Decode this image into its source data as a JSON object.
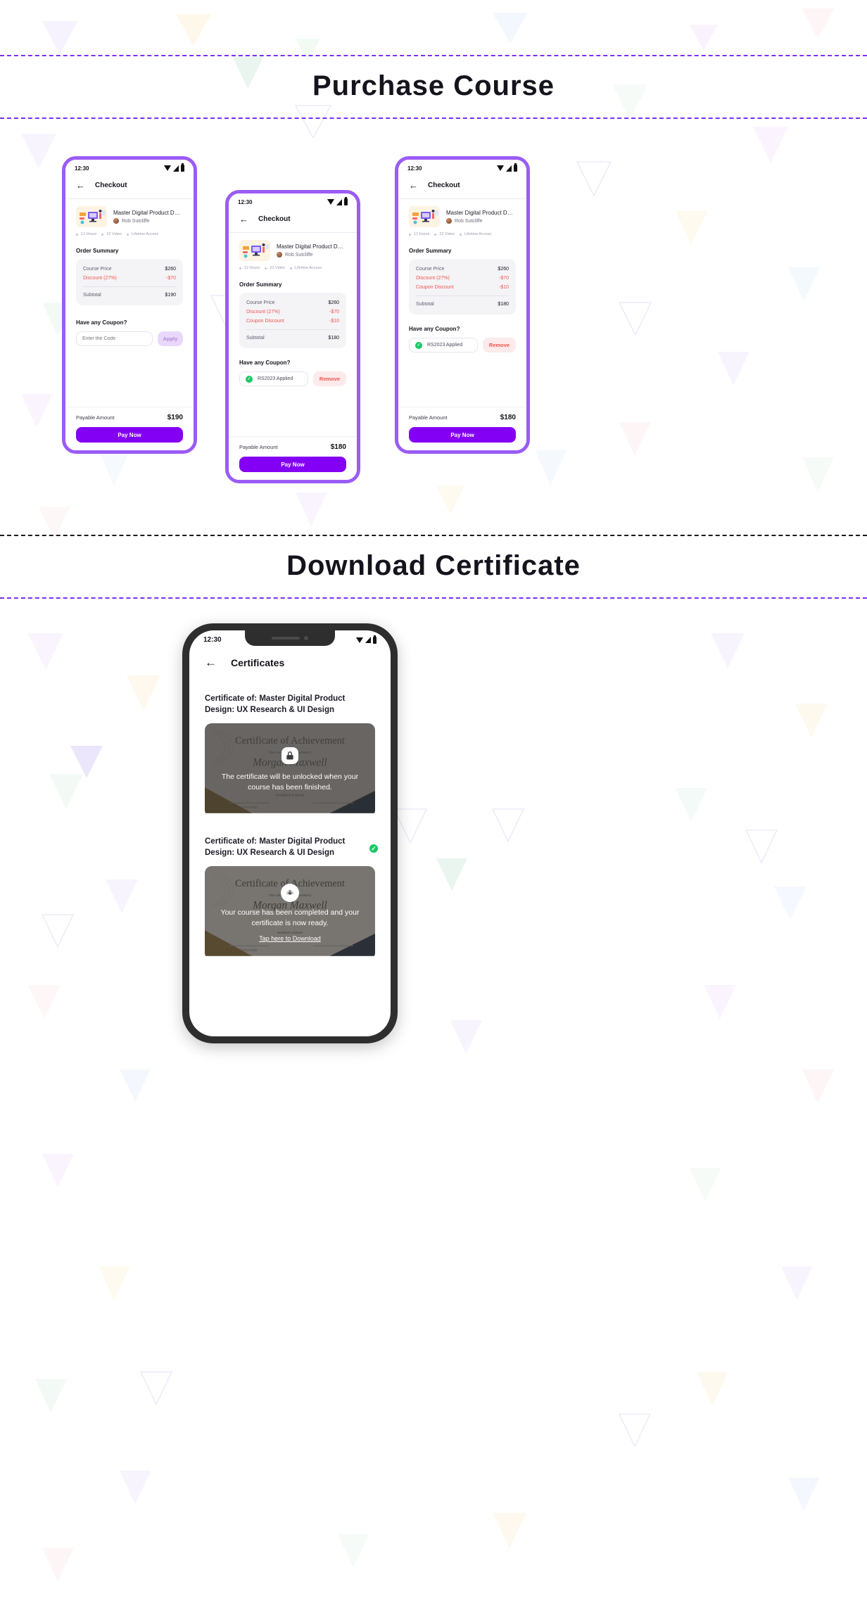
{
  "sections": [
    {
      "title": "Purchase  Course"
    },
    {
      "title": "Download Certificate"
    }
  ],
  "status_bar": {
    "time": "12:30"
  },
  "checkout": {
    "appbar_title": "Checkout",
    "back_icon": "arrow-left-icon",
    "course": {
      "title": "Master Digital Product Design:...",
      "author": "Rob Sutcliffe",
      "chips": [
        "12 Hours",
        "22 Video",
        "Lifetime Access"
      ]
    },
    "order_summary_label": "Order Summary",
    "coupon_label": "Have any Coupon?",
    "coupon_placeholder": "Enter the Code",
    "apply_label": "Apply",
    "remove_label": "Remove",
    "coupon_applied_text": "RS2023 Applied",
    "payable_label": "Payable Amount",
    "pay_label": "Pay Now"
  },
  "phone1": {
    "rows": [
      {
        "label": "Course Price",
        "value": "$260",
        "negative": false
      },
      {
        "label": "Discount (27%)",
        "value": "-$70",
        "negative": true
      },
      {
        "label": "Subtotal",
        "value": "$190",
        "negative": false
      }
    ],
    "payable_amount": "$190",
    "coupon_state": "empty"
  },
  "phone2": {
    "rows": [
      {
        "label": "Course Price",
        "value": "$260",
        "negative": false
      },
      {
        "label": "Discount (27%)",
        "value": "-$70",
        "negative": true
      },
      {
        "label": "Coupon Discount",
        "value": "-$10",
        "negative": true
      },
      {
        "label": "Subtotal",
        "value": "$180",
        "negative": false
      }
    ],
    "payable_amount": "$180",
    "coupon_state": "applied"
  },
  "phone3": {
    "rows": [
      {
        "label": "Course Price",
        "value": "$260",
        "negative": false
      },
      {
        "label": "Discount (27%)",
        "value": "-$70",
        "negative": true
      },
      {
        "label": "Coupon Discount",
        "value": "-$10",
        "negative": true
      },
      {
        "label": "Subtotal",
        "value": "$180",
        "negative": false
      }
    ],
    "payable_amount": "$180",
    "coupon_state": "applied"
  },
  "certificates": {
    "appbar_title": "Certificates",
    "back_icon": "arrow-left-icon",
    "items": [
      {
        "heading": "Certificate of: Master Digital Product Design: UX Research & UI Design",
        "state": "locked",
        "icon": "lock-icon",
        "message": "The certificate will be unlocked when your course has been finished.",
        "link": ""
      },
      {
        "heading": "Certificate of: Master Digital Product Design: UX Research & UI Design",
        "state": "ready",
        "icon": "download-cloud-icon",
        "message": "Your course has been completed and your certificate is now ready.",
        "link": "Tap here to Download",
        "badge_icon": "check-circle-icon"
      }
    ],
    "certificate_art": {
      "title": "Certificate of Achievement",
      "subtitle": "This certificate is awarded to",
      "name": "Morgan Maxwell",
      "body": "incididunt ut labore",
      "signature_label": "SIGNATURE"
    }
  },
  "colors": {
    "accent": "#8400f5",
    "frame": "#9a5cf5",
    "danger": "#f0544f",
    "success": "#18c964"
  }
}
